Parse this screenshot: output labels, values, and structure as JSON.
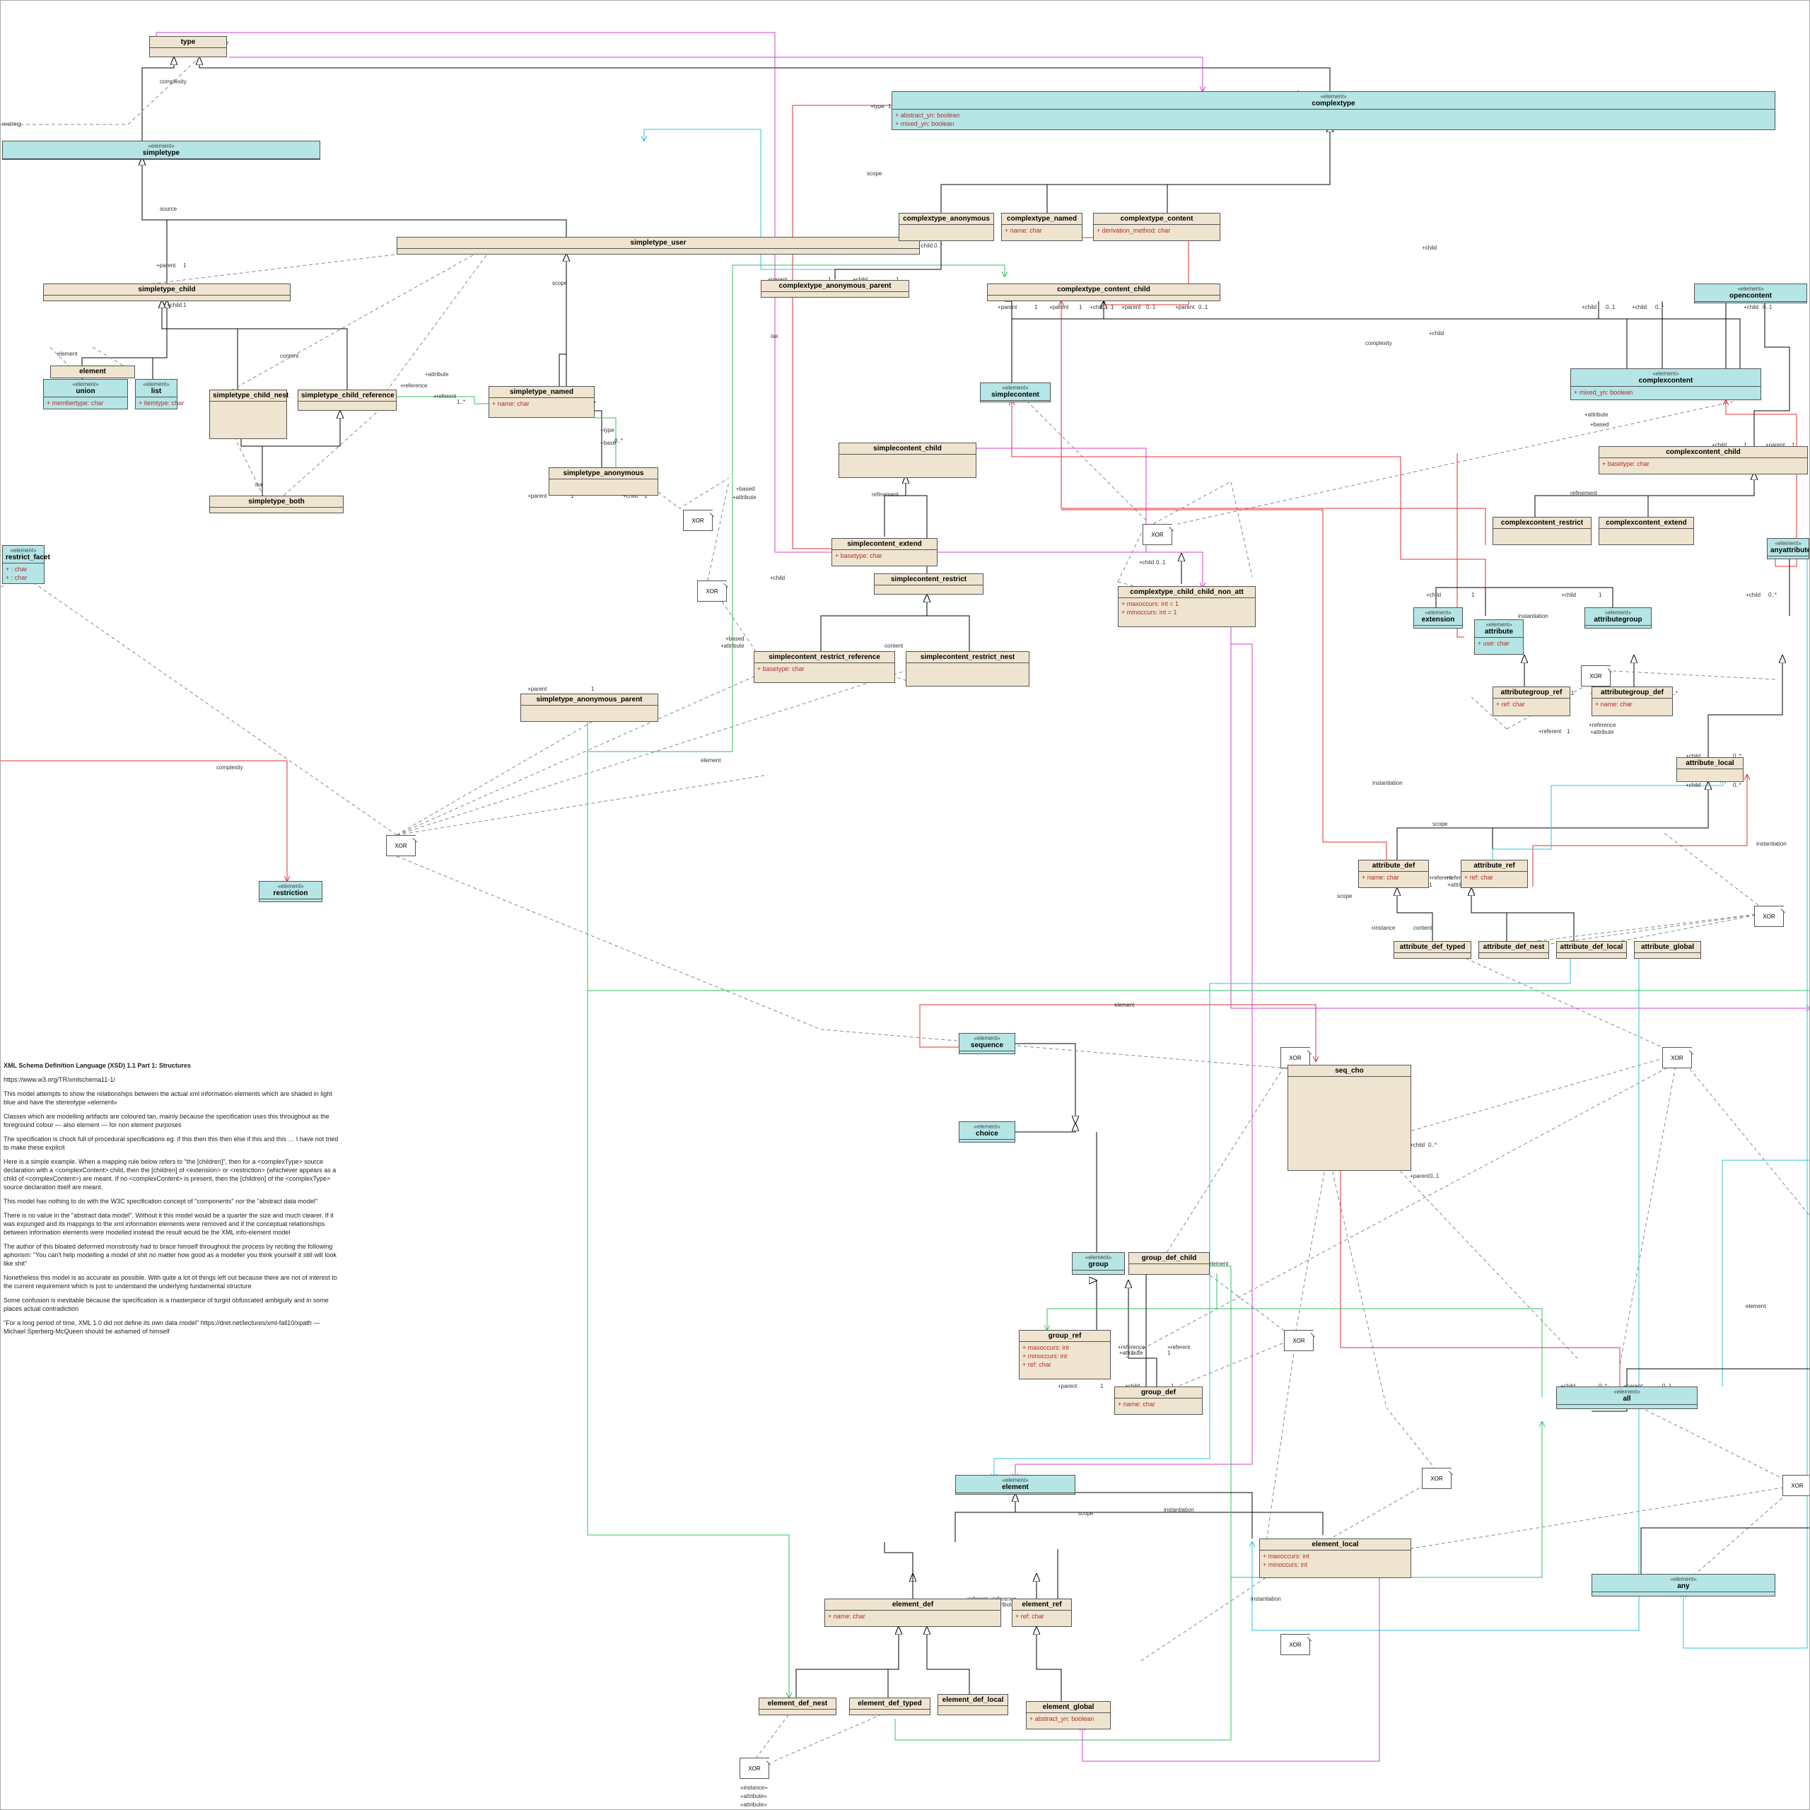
{
  "colors": {
    "element": "#b5e5e5",
    "class": "#efe4cf",
    "line_inherit": "#000000",
    "line_dashed": "#777777",
    "line_red": "#e03030",
    "line_green": "#30c060",
    "line_magenta": "#d040d0",
    "line_cyan": "#30c0e0"
  },
  "stereotypes": {
    "element": "«element»"
  },
  "multiplicities": {
    "one": "1",
    "zero_one": "0..1",
    "zero_star": "0..*",
    "one_star": "1..*"
  },
  "role_labels": {
    "base": "+base",
    "type": "+type",
    "scope": "scope",
    "source": "source",
    "child": "+child",
    "parent": "+parent",
    "attribute": "+attribute",
    "referent": "+referent",
    "reference": "+reference",
    "isa": "isa",
    "refinement": "refinement",
    "complexity": "complexity",
    "instance": "+instance",
    "based": "+based",
    "restring": "restring",
    "element": "element",
    "content": "content",
    "instantiation": "instantiation"
  },
  "classes": {
    "type": {
      "name": "type",
      "stereo": "",
      "attrs": []
    },
    "simpletype": {
      "name": "simpletype",
      "stereo": "«element»",
      "attrs": []
    },
    "simpletype_user": {
      "name": "simpletype_user",
      "stereo": "",
      "attrs": []
    },
    "simpletype_child": {
      "name": "simpletype_child",
      "stereo": "",
      "attrs": []
    },
    "element_top": {
      "name": "element",
      "stereo": "",
      "attrs": []
    },
    "union": {
      "name": "union",
      "stereo": "«element»",
      "attrs": [
        {
          "t": "+ membertype: char",
          "k": "pos"
        }
      ]
    },
    "list": {
      "name": "list",
      "stereo": "«element»",
      "attrs": [
        {
          "t": "+ itemtype: char",
          "k": "pos"
        }
      ]
    },
    "restrict_facet": {
      "name": "restrict_facet",
      "stereo": "«element»",
      "attrs": [
        {
          "t": "+ : char",
          "k": "pos"
        },
        {
          "t": "+ : char",
          "k": "pos"
        }
      ]
    },
    "simpletype_child_nest": {
      "name": "simpletype_child_nest",
      "stereo": "",
      "attrs": []
    },
    "simpletype_child_reference": {
      "name": "simpletype_child_reference",
      "stereo": "",
      "attrs": []
    },
    "simpletype_both": {
      "name": "simpletype_both",
      "stereo": "",
      "attrs": []
    },
    "simpletype_named": {
      "name": "simpletype_named",
      "stereo": "",
      "attrs": [
        {
          "t": "+ name: char",
          "k": "pos"
        }
      ]
    },
    "simpletype_anonymous": {
      "name": "simpletype_anonymous",
      "stereo": "",
      "attrs": []
    },
    "simpletype_anonymous_parent": {
      "name": "simpletype_anonymous_parent",
      "stereo": "",
      "attrs": []
    },
    "restriction": {
      "name": "restriction",
      "stereo": "«element»",
      "attrs": []
    },
    "complextype": {
      "name": "complextype",
      "stereo": "«element»",
      "attrs": [
        {
          "t": "+ abstract_yn: boolean",
          "k": "pos"
        },
        {
          "t": "+ mixed_yn: boolean",
          "k": "pos"
        }
      ]
    },
    "complextype_anonymous": {
      "name": "complextype_anonymous",
      "stereo": "",
      "attrs": []
    },
    "complextype_named": {
      "name": "complextype_named",
      "stereo": "",
      "attrs": [
        {
          "t": "+ name: char",
          "k": "pos"
        }
      ]
    },
    "complextype_content": {
      "name": "complextype_content",
      "stereo": "",
      "attrs": [
        {
          "t": "+ derivation_method: char",
          "k": "pos"
        }
      ]
    },
    "complextype_anonymous_parent": {
      "name": "complextype_anonymous_parent",
      "stereo": "",
      "attrs": []
    },
    "complextype_content_child": {
      "name": "complextype_content_child",
      "stereo": "",
      "attrs": []
    },
    "simplecontent": {
      "name": "simplecontent",
      "stereo": "«element»",
      "attrs": []
    },
    "simplecontent_child": {
      "name": "simplecontent_child",
      "stereo": "",
      "attrs": []
    },
    "simplecontent_extend": {
      "name": "simplecontent_extend",
      "stereo": "",
      "attrs": [
        {
          "t": "+ basetype: char",
          "k": "pos"
        }
      ]
    },
    "simplecontent_restrict": {
      "name": "simplecontent_restrict",
      "stereo": "",
      "attrs": []
    },
    "simplecontent_restrict_reference": {
      "name": "simplecontent_restrict_reference",
      "stereo": "",
      "attrs": [
        {
          "t": "+ basetype: char",
          "k": "pos"
        }
      ]
    },
    "simplecontent_restrict_nest": {
      "name": "simplecontent_restrict_nest",
      "stereo": "",
      "attrs": []
    },
    "complextype_child_child_non_att": {
      "name": "complextype_child_child_non_att",
      "stereo": "",
      "attrs": [
        {
          "t": "+ maxoccurs: int = 1",
          "k": "pos"
        },
        {
          "t": "+ minoccurs: int = 1",
          "k": "pos"
        }
      ]
    },
    "opencontent": {
      "name": "opencontent",
      "stereo": "«element»",
      "attrs": []
    },
    "complexcontent": {
      "name": "complexcontent",
      "stereo": "«element»",
      "attrs": [
        {
          "t": "+ mixed_yn: boolean",
          "k": "pos"
        }
      ]
    },
    "complexcontent_child": {
      "name": "complexcontent_child",
      "stereo": "",
      "attrs": [
        {
          "t": "+ basetype: char",
          "k": "pos"
        }
      ]
    },
    "complexcontent_restrict": {
      "name": "complexcontent_restrict",
      "stereo": "",
      "attrs": []
    },
    "complexcontent_extend": {
      "name": "complexcontent_extend",
      "stereo": "",
      "attrs": []
    },
    "extension": {
      "name": "extension",
      "stereo": "«element»",
      "attrs": []
    },
    "attribute": {
      "name": "attribute",
      "stereo": "«element»",
      "attrs": [
        {
          "t": "+ use: char",
          "k": "pos"
        }
      ]
    },
    "attributegroup": {
      "name": "attributegroup",
      "stereo": "«element»",
      "attrs": []
    },
    "anyattribute": {
      "name": "anyattribute",
      "stereo": "«element»",
      "attrs": []
    },
    "attributegroup_ref": {
      "name": "attributegroup_ref",
      "stereo": "",
      "attrs": [
        {
          "t": "+ ref: char",
          "k": "pos"
        }
      ]
    },
    "attributegroup_def": {
      "name": "attributegroup_def",
      "stereo": "",
      "attrs": [
        {
          "t": "+ name: char",
          "k": "pos"
        }
      ]
    },
    "attribute_local": {
      "name": "attribute_local",
      "stereo": "",
      "attrs": []
    },
    "attribute_def": {
      "name": "attribute_def",
      "stereo": "",
      "attrs": [
        {
          "t": "+ name: char",
          "k": "pos"
        }
      ]
    },
    "attribute_ref": {
      "name": "attribute_ref",
      "stereo": "",
      "attrs": [
        {
          "t": "+ ref: char",
          "k": "pos"
        }
      ]
    },
    "attribute_def_typed": {
      "name": "attribute_def_typed",
      "stereo": "",
      "attrs": []
    },
    "attribute_def_nest": {
      "name": "attribute_def_nest",
      "stereo": "",
      "attrs": []
    },
    "attribute_def_local": {
      "name": "attribute_def_local",
      "stereo": "",
      "attrs": []
    },
    "attribute_global": {
      "name": "attribute_global",
      "stereo": "",
      "attrs": []
    },
    "sequence": {
      "name": "sequence",
      "stereo": "«element»",
      "attrs": []
    },
    "choice": {
      "name": "choice",
      "stereo": "«element»",
      "attrs": []
    },
    "seq_cho": {
      "name": "seq_cho",
      "stereo": "",
      "attrs": []
    },
    "group": {
      "name": "group",
      "stereo": "«element»",
      "attrs": []
    },
    "group_def_child": {
      "name": "group_def_child",
      "stereo": "",
      "attrs": []
    },
    "group_ref": {
      "name": "group_ref",
      "stereo": "",
      "attrs": [
        {
          "t": "+ maxoccurs: int",
          "k": "pos"
        },
        {
          "t": "+ minoccurs: int",
          "k": "pos"
        },
        {
          "t": "+ ref: char",
          "k": "pos"
        }
      ]
    },
    "group_def": {
      "name": "group_def",
      "stereo": "",
      "attrs": [
        {
          "t": "+ name: char",
          "k": "pos"
        }
      ]
    },
    "all": {
      "name": "all",
      "stereo": "«element»",
      "attrs": []
    },
    "any": {
      "name": "any",
      "stereo": "«element»",
      "attrs": []
    },
    "element": {
      "name": "element",
      "stereo": "«element»",
      "attrs": []
    },
    "element_local": {
      "name": "element_local",
      "stereo": "",
      "attrs": [
        {
          "t": "+ maxoccurs: int",
          "k": "pos"
        },
        {
          "t": "+ minoccurs: int",
          "k": "pos"
        }
      ]
    },
    "element_def": {
      "name": "element_def",
      "stereo": "",
      "attrs": [
        {
          "t": "+ name: char",
          "k": "pos"
        }
      ]
    },
    "element_ref": {
      "name": "element_ref",
      "stereo": "",
      "attrs": [
        {
          "t": "+ ref: char",
          "k": "pos"
        }
      ]
    },
    "element_def_nest": {
      "name": "element_def_nest",
      "stereo": "",
      "attrs": []
    },
    "element_def_typed": {
      "name": "element_def_typed",
      "stereo": "",
      "attrs": []
    },
    "element_def_local": {
      "name": "element_def_local",
      "stereo": "",
      "attrs": []
    },
    "element_global": {
      "name": "element_global",
      "stereo": "",
      "attrs": [
        {
          "t": "+ abstract_yn: boolean",
          "k": "pos"
        }
      ]
    }
  },
  "xor_label": "XOR",
  "notes": {
    "title": "XML Schema Definition Language (XSD) 1.1 Part 1: Structures",
    "url": "https://www.w3.org/TR/xmlschema11-1/",
    "p1": "This model attempts to show the relationships between the actual xml information elements which are shaded in light blue and have the stereotype «element»",
    "p2": "Classes which are modelling artifacts are coloured tan, mainly because the specification uses this throughout as the foreground colour — also element — for non element purposes",
    "p3": "The specification is chock full of procedural specifications eg. if this then this then else if this and this …   I have not tried to make these explicit",
    "p4": "Here is a simple example. When a mapping rule below refers to \"the [children]\", then for a <complexType> source declaration with a <complexContent> child, then the [children] of <extension> or <restriction> (whichever appears as a child of <complexContent>) are meant. If no <complexContent> is present, then the [children] of the <complexType> source declaration itself are meant.",
    "p5": "This model has nothing to do with the W3C specification concept of \"components\" nor the \"abstract data model\"",
    "p6": "There is no value in the \"abstract data model\". Without it this model would be a quarter the size and much clearer. If it was expunged and its mappings to the xml information elements were removed and if the conceptual relationships between information elements were modelled instead the result would be the XML info-element model",
    "p7": "The author of this bloated deformed monstrosity had to brace himself throughout the process by reciting the following aphorism: \"You can't help modelling a model of shit no matter how good as a modeller you think yourself it still will look like shit\"",
    "p8": "Nonetheless this model is as accurate as possible. With quite a lot of things left out because there are not of interest to the current requirement which is just to understand the underlying fundamental structure",
    "p9": "Some confusion is inevitable because the specification is a masterpiece of turgid obfuscated ambiguity and in some places actual contradiction",
    "p10": "\"For a long period of time, XML 1.0 did not define its own data model\" https://dret.net/lectures/xml-fall10/xpath — Michael Sperberg-McQueen should be ashamed of himself"
  },
  "footer_labels": [
    "«instance»",
    "«attribute»",
    "«attribute»"
  ]
}
